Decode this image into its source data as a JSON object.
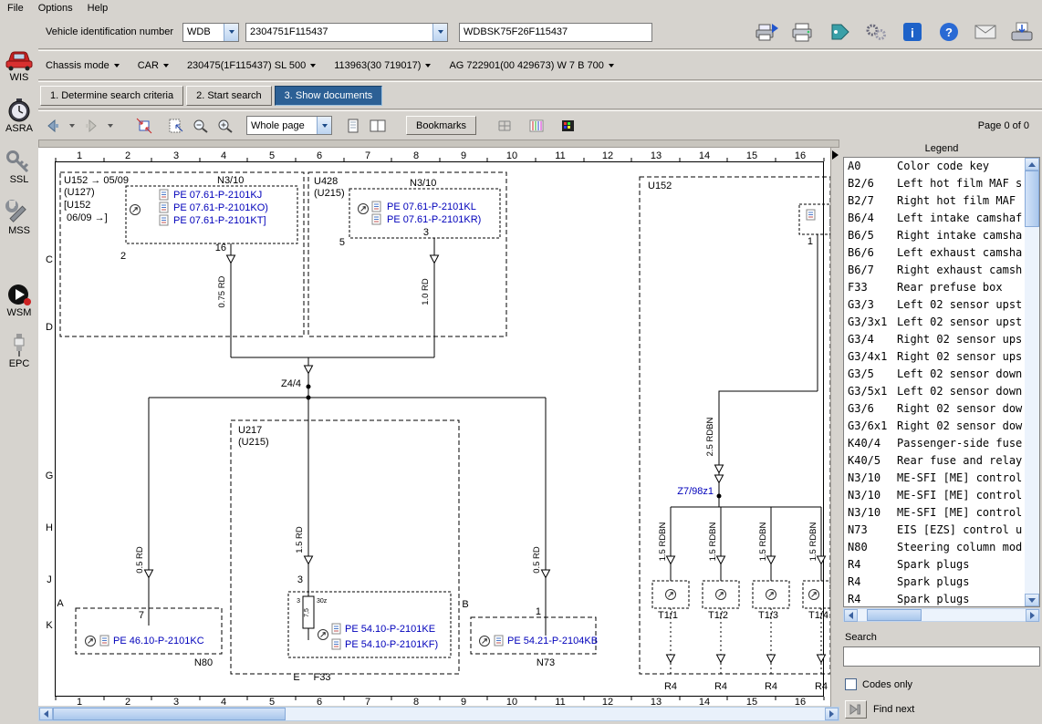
{
  "menu": {
    "file": "File",
    "options": "Options",
    "help": "Help"
  },
  "sidebar": {
    "items": [
      {
        "label": "WIS"
      },
      {
        "label": "ASRA"
      },
      {
        "label": "SSL"
      },
      {
        "label": "MSS"
      },
      {
        "label": "WSM"
      },
      {
        "label": "EPC"
      }
    ]
  },
  "vin_row": {
    "label": "Vehicle identification number",
    "wmi": "WDB",
    "vin_short": "2304751F115437",
    "vin_full": "WDBSK75F26F115437"
  },
  "chassis_row": {
    "label": "Chassis mode",
    "mode": "CAR",
    "items": [
      "230475(1F115437) SL 500",
      "113963(30 719017)",
      "AG 722901(00 429673) W 7 B 700"
    ]
  },
  "tabs": [
    {
      "label": "1. Determine search criteria"
    },
    {
      "label": "2. Start search"
    },
    {
      "label": "3. Show documents"
    }
  ],
  "doc_toolbar": {
    "zoom_mode": "Whole page",
    "bookmarks_label": "Bookmarks",
    "page_info": "Page 0 of 0"
  },
  "icons": {
    "info_glyph": "i",
    "help_glyph": "?"
  },
  "legend": {
    "title": "Legend",
    "rows": [
      [
        "A0",
        "Color code key"
      ],
      [
        "B2/6",
        "Left hot film MAF s"
      ],
      [
        "B2/7",
        "Right hot film MAF"
      ],
      [
        "B6/4",
        "Left intake camshaf"
      ],
      [
        "B6/5",
        "Right intake camsha"
      ],
      [
        "B6/6",
        "Left exhaust camsha"
      ],
      [
        "B6/7",
        "Right exhaust camsh"
      ],
      [
        "F33",
        "Rear prefuse box"
      ],
      [
        "G3/3",
        "Left 02 sensor upst"
      ],
      [
        "G3/3x1",
        "Left 02 sensor upst"
      ],
      [
        "G3/4",
        "Right 02 sensor ups"
      ],
      [
        "G3/4x1",
        "Right 02 sensor ups"
      ],
      [
        "G3/5",
        "Left 02 sensor down"
      ],
      [
        "G3/5x1",
        "Left 02 sensor down"
      ],
      [
        "G3/6",
        "Right 02 sensor dow"
      ],
      [
        "G3/6x1",
        "Right 02 sensor dow"
      ],
      [
        "K40/4",
        "Passenger-side fuse"
      ],
      [
        "K40/5",
        "Rear fuse and relay"
      ],
      [
        "N3/10",
        "ME-SFI [ME] control"
      ],
      [
        "N3/10",
        "ME-SFI [ME] control"
      ],
      [
        "N3/10",
        "ME-SFI [ME] control"
      ],
      [
        "N73",
        "EIS [EZS] control u"
      ],
      [
        "N80",
        "Steering column mod"
      ],
      [
        "R4",
        "Spark plugs"
      ],
      [
        "R4",
        "Spark plugs"
      ],
      [
        "R4",
        "Spark plugs"
      ]
    ]
  },
  "search": {
    "label": "Search",
    "input_value": "",
    "codes_only_label": "Codes only",
    "find_next_label": "Find next"
  },
  "diagram": {
    "ruler_cols": [
      "1",
      "2",
      "3",
      "4",
      "5",
      "6",
      "7",
      "8",
      "9",
      "10",
      "11",
      "12",
      "13",
      "14",
      "15",
      "16"
    ],
    "ruler_rows": [
      "C",
      "D",
      "G",
      "H",
      "J",
      "K"
    ],
    "box_u152_left": {
      "line1": "U152 → 05/09",
      "line2": "(U127)",
      "line3": "[U152",
      "line4": "06/09 →]",
      "module": "N3/10",
      "links": [
        "PE 07.61-P-2101KJ",
        "PE 07.61-P-2101KO)",
        "PE 07.61-P-2101KT]"
      ],
      "pin_a": "2",
      "pin_b": "16",
      "wire": "0.75 RD"
    },
    "box_u428": {
      "title": "U428",
      "subtitle": "(U215)",
      "module": "N3/10",
      "links": [
        "PE 07.61-P-2101KL",
        "PE 07.61-P-2101KR)"
      ],
      "pin_a": "5",
      "pin_b": "3",
      "wire": "1.0 RD"
    },
    "box_u152_right": {
      "title": "U152",
      "pin": "1"
    },
    "junction_z44": "Z4/4",
    "box_u217": {
      "title": "U217",
      "subtitle": "(U215)"
    },
    "n80": {
      "marker": "A",
      "pin": "7",
      "wire": "0.5 RD",
      "link": "PE 46.10-P-2101KC",
      "label": "N80"
    },
    "f33": {
      "pin": "3",
      "wire": "1.5 RD",
      "fuse_value": "7,5",
      "terminal": "30z",
      "terminal2": "3",
      "links": [
        "PE 54.10-P-2101KE",
        "PE 54.10-P-2101KF)"
      ],
      "marker": "E",
      "label": "F33"
    },
    "n73": {
      "marker": "B",
      "pin": "1",
      "wire": "0.5 RD",
      "link": "PE 54.21-P-2104KB",
      "label": "N73"
    },
    "ignition": {
      "wire_main": "2.5 RDBN",
      "node": "Z7/98z1",
      "wire_branch": "1.5 RDBN",
      "coils": [
        "T1/1",
        "T1/2",
        "T1/3",
        "T1/4"
      ],
      "plug": "R4"
    }
  }
}
